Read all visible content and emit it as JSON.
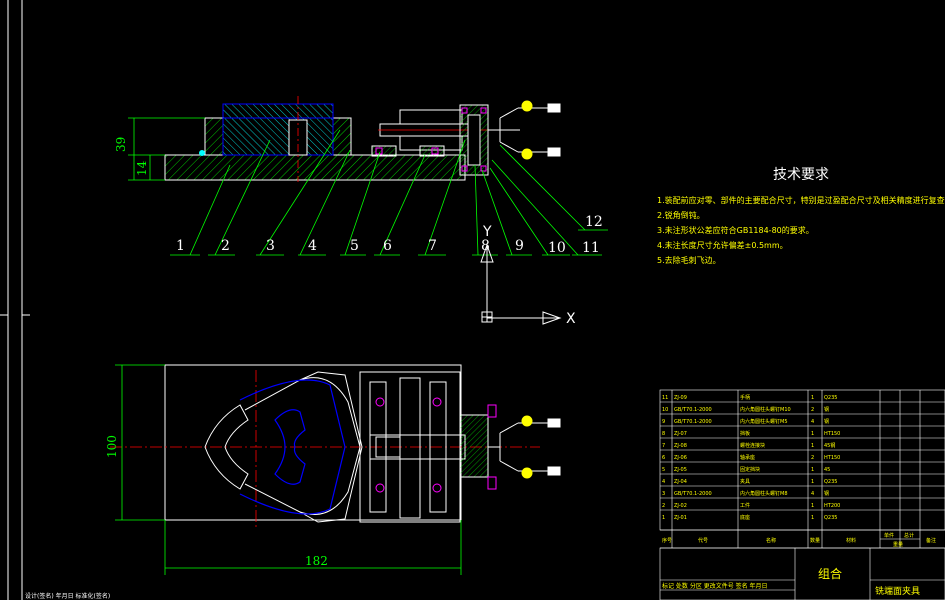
{
  "technical_requirements": {
    "title": "技术要求",
    "items": [
      "1.装配前应对零、部件的主要配合尺寸，特别是过盈配合尺寸及相关精度进行复查。",
      "2.锐角倒钝。",
      "3.未注形状公差应符合GB1184-80的要求。",
      "4.未注长度尺寸允许偏差±0.5mm。",
      "5.去除毛刺飞边。"
    ]
  },
  "balloons": [
    "1",
    "2",
    "3",
    "4",
    "5",
    "6",
    "7",
    "8",
    "9",
    "10",
    "11",
    "12"
  ],
  "dimensions": {
    "overall_height": "39",
    "base_thickness": "14",
    "base_width": "100",
    "base_length": "182"
  },
  "axes": {
    "x": "X",
    "y": "Y"
  },
  "bom": {
    "headers": [
      "序号",
      "代号",
      "名称",
      "数量",
      "材料",
      "单件",
      "总计",
      "备注"
    ],
    "header_group": "重量",
    "rows": [
      [
        "11",
        "ZJ-09",
        "手柄",
        "1",
        "Q235",
        "",
        "",
        ""
      ],
      [
        "10",
        "GB/T70.1-2000",
        "内六角圆柱头螺钉M10",
        "2",
        "钢",
        "",
        "",
        ""
      ],
      [
        "9",
        "GB/T70.1-2000",
        "内六角圆柱头螺钉M5",
        "4",
        "钢",
        "",
        "",
        ""
      ],
      [
        "8",
        "ZJ-07",
        "挡板",
        "1",
        "HT150",
        "",
        "",
        ""
      ],
      [
        "7",
        "ZJ-08",
        "螺栓连接块",
        "1",
        "45钢",
        "",
        "",
        ""
      ],
      [
        "6",
        "ZJ-06",
        "轴承座",
        "2",
        "HT150",
        "",
        "",
        ""
      ],
      [
        "5",
        "ZJ-05",
        "固定挡块",
        "1",
        "45",
        "",
        "",
        ""
      ],
      [
        "4",
        "ZJ-04",
        "夹具",
        "1",
        "Q235",
        "",
        "",
        ""
      ],
      [
        "3",
        "GB/T70.1-2000",
        "内六角圆柱头螺钉M8",
        "4",
        "钢",
        "",
        "",
        ""
      ],
      [
        "2",
        "ZJ-02",
        "工件",
        "1",
        "HT200",
        "",
        "",
        ""
      ],
      [
        "1",
        "ZJ-01",
        "底座",
        "1",
        "Q235",
        "",
        "",
        ""
      ]
    ]
  },
  "title_block": {
    "drawing_name": "组合",
    "footer_left": "标记 处数 分区 更改文件号 签名 年月日",
    "footer_right": "铣端面夹具",
    "bottom_edge_text": "设计(签名)  年月日  标准化(签名)"
  },
  "colors": {
    "background": "#000000",
    "frame": "#ffffff",
    "part_outline": "#0000ff",
    "hatch_body": "#00ffff",
    "centerline": "#ff0000",
    "dimension": "#00ff00",
    "leader": "#00ff00",
    "fastener": "#ff00ff",
    "yellow_text": "#ffff00"
  }
}
